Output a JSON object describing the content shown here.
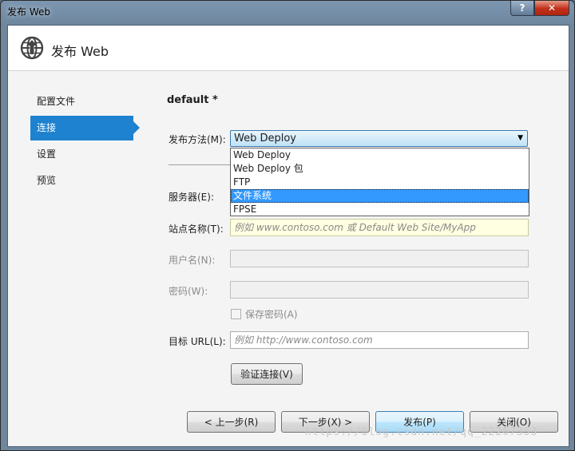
{
  "window": {
    "title": "发布 Web",
    "help_glyph": "?",
    "close_glyph": "✕"
  },
  "header": {
    "title": "发布 Web",
    "icon": "globe-publish-icon"
  },
  "nav": {
    "items": [
      {
        "label": "配置文件",
        "active": false
      },
      {
        "label": "连接",
        "active": true
      },
      {
        "label": "设置",
        "active": false
      },
      {
        "label": "预览",
        "active": false
      }
    ]
  },
  "form": {
    "profile_name": "default *",
    "publish_method_label": "发布方法(M):",
    "publish_method_value": "Web Deploy",
    "publish_method_options": [
      "Web Deploy",
      "Web Deploy 包",
      "FTP",
      "文件系统",
      "FPSE"
    ],
    "highlighted_option": "文件系统",
    "server_label": "服务器(E):",
    "site_name_label": "站点名称(T):",
    "site_name_placeholder": "例如 www.contoso.com 或 Default Web Site/MyApp",
    "username_label": "用户名(N):",
    "password_label": "密码(W):",
    "save_password_label": "保存密码(A)",
    "target_url_label": "目标 URL(L):",
    "target_url_placeholder": "例如 http://www.contoso.com",
    "validate_button": "验证连接(V)"
  },
  "footer": {
    "prev_button": "< 上一步(R)",
    "next_button": "下一步(X) >",
    "publish_button": "发布(P)",
    "close_button": "关闭(O)"
  },
  "watermark": "https://blog.csdn.net/qq_22267353",
  "colors": {
    "accent": "#1e82d0",
    "selection": "#3399ff",
    "hint_field": "#ffffe1"
  }
}
